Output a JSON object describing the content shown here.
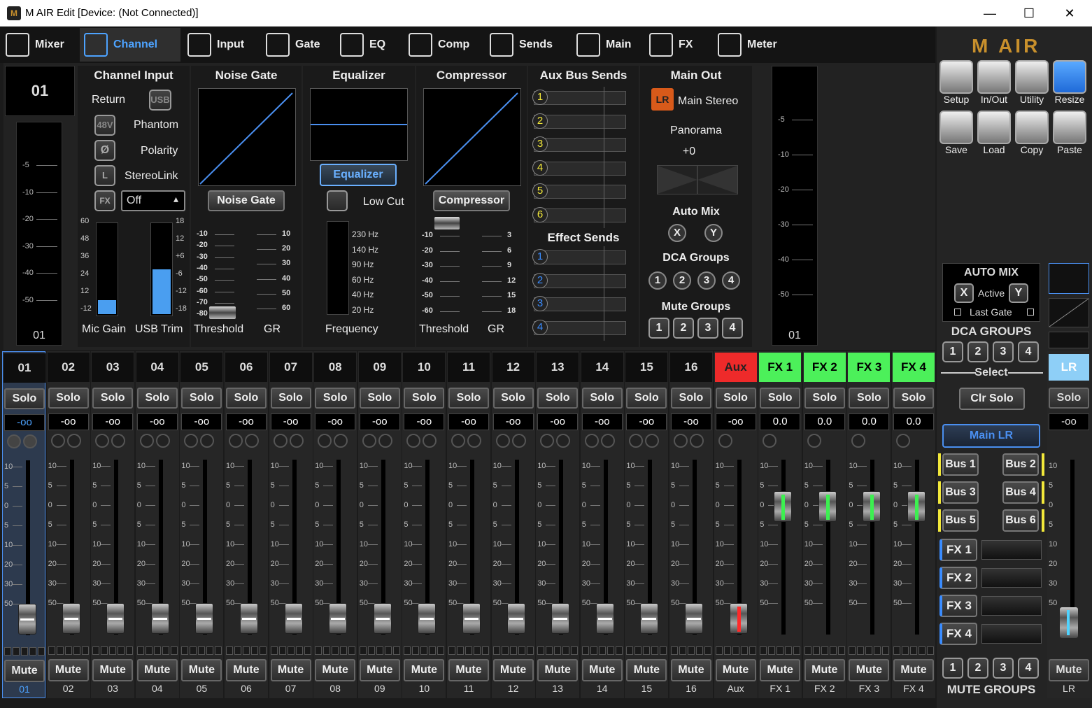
{
  "window": {
    "title": "M AIR Edit [Device: (Not Connected)]",
    "icon": "mair-app-icon",
    "minimize": "—",
    "maximize": "☐",
    "close": "✕"
  },
  "nav": {
    "tabs": [
      {
        "label": "Mixer",
        "icon": "mixer-icon"
      },
      {
        "label": "Channel",
        "icon": "channel-icon",
        "active": true
      },
      {
        "label": "Input",
        "icon": "input-icon"
      },
      {
        "label": "Gate",
        "icon": "gate-icon"
      },
      {
        "label": "EQ",
        "icon": "eq-icon"
      },
      {
        "label": "Comp",
        "icon": "comp-icon"
      },
      {
        "label": "Sends",
        "icon": "sends-icon"
      },
      {
        "label": "Main",
        "icon": "main-icon"
      },
      {
        "label": "FX",
        "icon": "fx-icon"
      },
      {
        "label": "Meter",
        "icon": "meter-icon"
      }
    ]
  },
  "channel": {
    "number": "01",
    "meter_left_scale": [
      "-5",
      "-10",
      "-20",
      "-30",
      "-40",
      "-50"
    ],
    "footer": "01"
  },
  "channel_input": {
    "title": "Channel Input",
    "return_label": "Return",
    "usb_btn": "USB",
    "phantom_btn": "48V",
    "phantom_label": "Phantom",
    "polarity_btn": "Ø",
    "polarity_label": "Polarity",
    "stereolink_btn": "L",
    "stereolink_label": "StereoLink",
    "fx_btn": "FX",
    "select_value": "Off",
    "mic_gain_scale": [
      "60",
      "48",
      "36",
      "24",
      "12",
      "-12"
    ],
    "usb_trim_scale": [
      "18",
      "12",
      "+6",
      "-6",
      "-12",
      "-18"
    ],
    "mic_gain_label": "Mic Gain",
    "usb_trim_label": "USB Trim",
    "mic_gain_level": 0.17,
    "usb_trim_level": 0.5
  },
  "noise_gate": {
    "title": "Noise Gate",
    "button": "Noise Gate",
    "threshold_scale": [
      "-10",
      "-20",
      "-30",
      "-40",
      "-50",
      "-60",
      "-70",
      "-80"
    ],
    "gr_scale": [
      "10",
      "20",
      "30",
      "40",
      "50",
      "60"
    ],
    "threshold_label": "Threshold",
    "gr_label": "GR"
  },
  "equalizer": {
    "title": "Equalizer",
    "button": "Equalizer",
    "lowcut_label": "Low Cut",
    "freq_scale": [
      "230 Hz",
      "140 Hz",
      "90 Hz",
      "60 Hz",
      "40 Hz",
      "20 Hz"
    ],
    "freq_label": "Frequency"
  },
  "compressor": {
    "title": "Compressor",
    "button": "Compressor",
    "threshold_scale": [
      "-10",
      "-20",
      "-30",
      "-40",
      "-50",
      "-60"
    ],
    "gr_scale": [
      "3",
      "6",
      "9",
      "12",
      "15",
      "18"
    ],
    "threshold_label": "Threshold",
    "gr_label": "GR"
  },
  "aux": {
    "title": "Aux Bus Sends",
    "sends": [
      "1",
      "2",
      "3",
      "4",
      "5",
      "6"
    ],
    "effect_title": "Effect Sends",
    "effects": [
      "1",
      "2",
      "3",
      "4"
    ]
  },
  "main_out": {
    "title": "Main Out",
    "lr_btn": "LR",
    "main_stereo": "Main Stereo",
    "panorama_label": "Panorama",
    "panorama_value": "+0",
    "automix_label": "Auto Mix",
    "automix_x": "X",
    "automix_y": "Y",
    "dca_label": "DCA Groups",
    "dca": [
      "1",
      "2",
      "3",
      "4"
    ],
    "mute_label": "Mute Groups",
    "mute": [
      "1",
      "2",
      "3",
      "4"
    ]
  },
  "right_meter": {
    "scale": [
      "-5",
      "-10",
      "-20",
      "-30",
      "-40",
      "-50"
    ],
    "footer": "01"
  },
  "strips": [
    {
      "num": "01",
      "val": "-oo",
      "foot": "01",
      "selected": true
    },
    {
      "num": "02",
      "val": "-oo",
      "foot": "02"
    },
    {
      "num": "03",
      "val": "-oo",
      "foot": "03"
    },
    {
      "num": "04",
      "val": "-oo",
      "foot": "04"
    },
    {
      "num": "05",
      "val": "-oo",
      "foot": "05"
    },
    {
      "num": "06",
      "val": "-oo",
      "foot": "06"
    },
    {
      "num": "07",
      "val": "-oo",
      "foot": "07"
    },
    {
      "num": "08",
      "val": "-oo",
      "foot": "08"
    },
    {
      "num": "09",
      "val": "-oo",
      "foot": "09"
    },
    {
      "num": "10",
      "val": "-oo",
      "foot": "10"
    },
    {
      "num": "11",
      "val": "-oo",
      "foot": "11"
    },
    {
      "num": "12",
      "val": "-oo",
      "foot": "12"
    },
    {
      "num": "13",
      "val": "-oo",
      "foot": "13"
    },
    {
      "num": "14",
      "val": "-oo",
      "foot": "14"
    },
    {
      "num": "15",
      "val": "-oo",
      "foot": "15"
    },
    {
      "num": "16",
      "val": "-oo",
      "foot": "16"
    },
    {
      "num": "Aux",
      "val": "-oo",
      "foot": "Aux",
      "kind": "aux"
    },
    {
      "num": "FX 1",
      "val": "0.0",
      "foot": "FX 1",
      "kind": "fx"
    },
    {
      "num": "FX 2",
      "val": "0.0",
      "foot": "FX 2",
      "kind": "fx"
    },
    {
      "num": "FX 3",
      "val": "0.0",
      "foot": "FX 3",
      "kind": "fx"
    },
    {
      "num": "FX 4",
      "val": "0.0",
      "foot": "FX 4",
      "kind": "fx"
    }
  ],
  "strip_labels": {
    "solo": "Solo",
    "mute": "Mute",
    "scale": [
      "10",
      "5",
      "0",
      "5",
      "10",
      "20",
      "30",
      "50"
    ]
  },
  "lr_strip": {
    "num": "LR",
    "solo": "Solo",
    "val": "-oo",
    "mute": "Mute",
    "foot": "LR"
  },
  "right_panel": {
    "logo": "M AIR",
    "buttons": [
      {
        "label": "Setup",
        "icon": "gear-icon"
      },
      {
        "label": "In/Out",
        "icon": "in-out-arrows-icon"
      },
      {
        "label": "Utility",
        "icon": "wrench-icon"
      },
      {
        "label": "Resize",
        "icon": "resize-icon"
      },
      {
        "label": "Save",
        "icon": "save-icon"
      },
      {
        "label": "Load",
        "icon": "folder-icon"
      },
      {
        "label": "Copy",
        "icon": "copy-icon"
      },
      {
        "label": "Paste",
        "icon": "paste-icon"
      }
    ],
    "automix_title": "AUTO MIX",
    "automix_x": "X",
    "automix_active": "Active",
    "automix_y": "Y",
    "last_gate": "Last Gate",
    "dca_title": "DCA GROUPS",
    "dca": [
      "1",
      "2",
      "3",
      "4"
    ],
    "select": "Select",
    "clr_solo": "Clr Solo",
    "main_lr": "Main LR",
    "buses": [
      "Bus 1",
      "Bus 2",
      "Bus 3",
      "Bus 4",
      "Bus 5",
      "Bus 6"
    ],
    "fx": [
      "FX 1",
      "FX 2",
      "FX 3",
      "FX 4"
    ],
    "mute_groups": [
      "1",
      "2",
      "3",
      "4"
    ],
    "mute_title": "MUTE GROUPS"
  }
}
